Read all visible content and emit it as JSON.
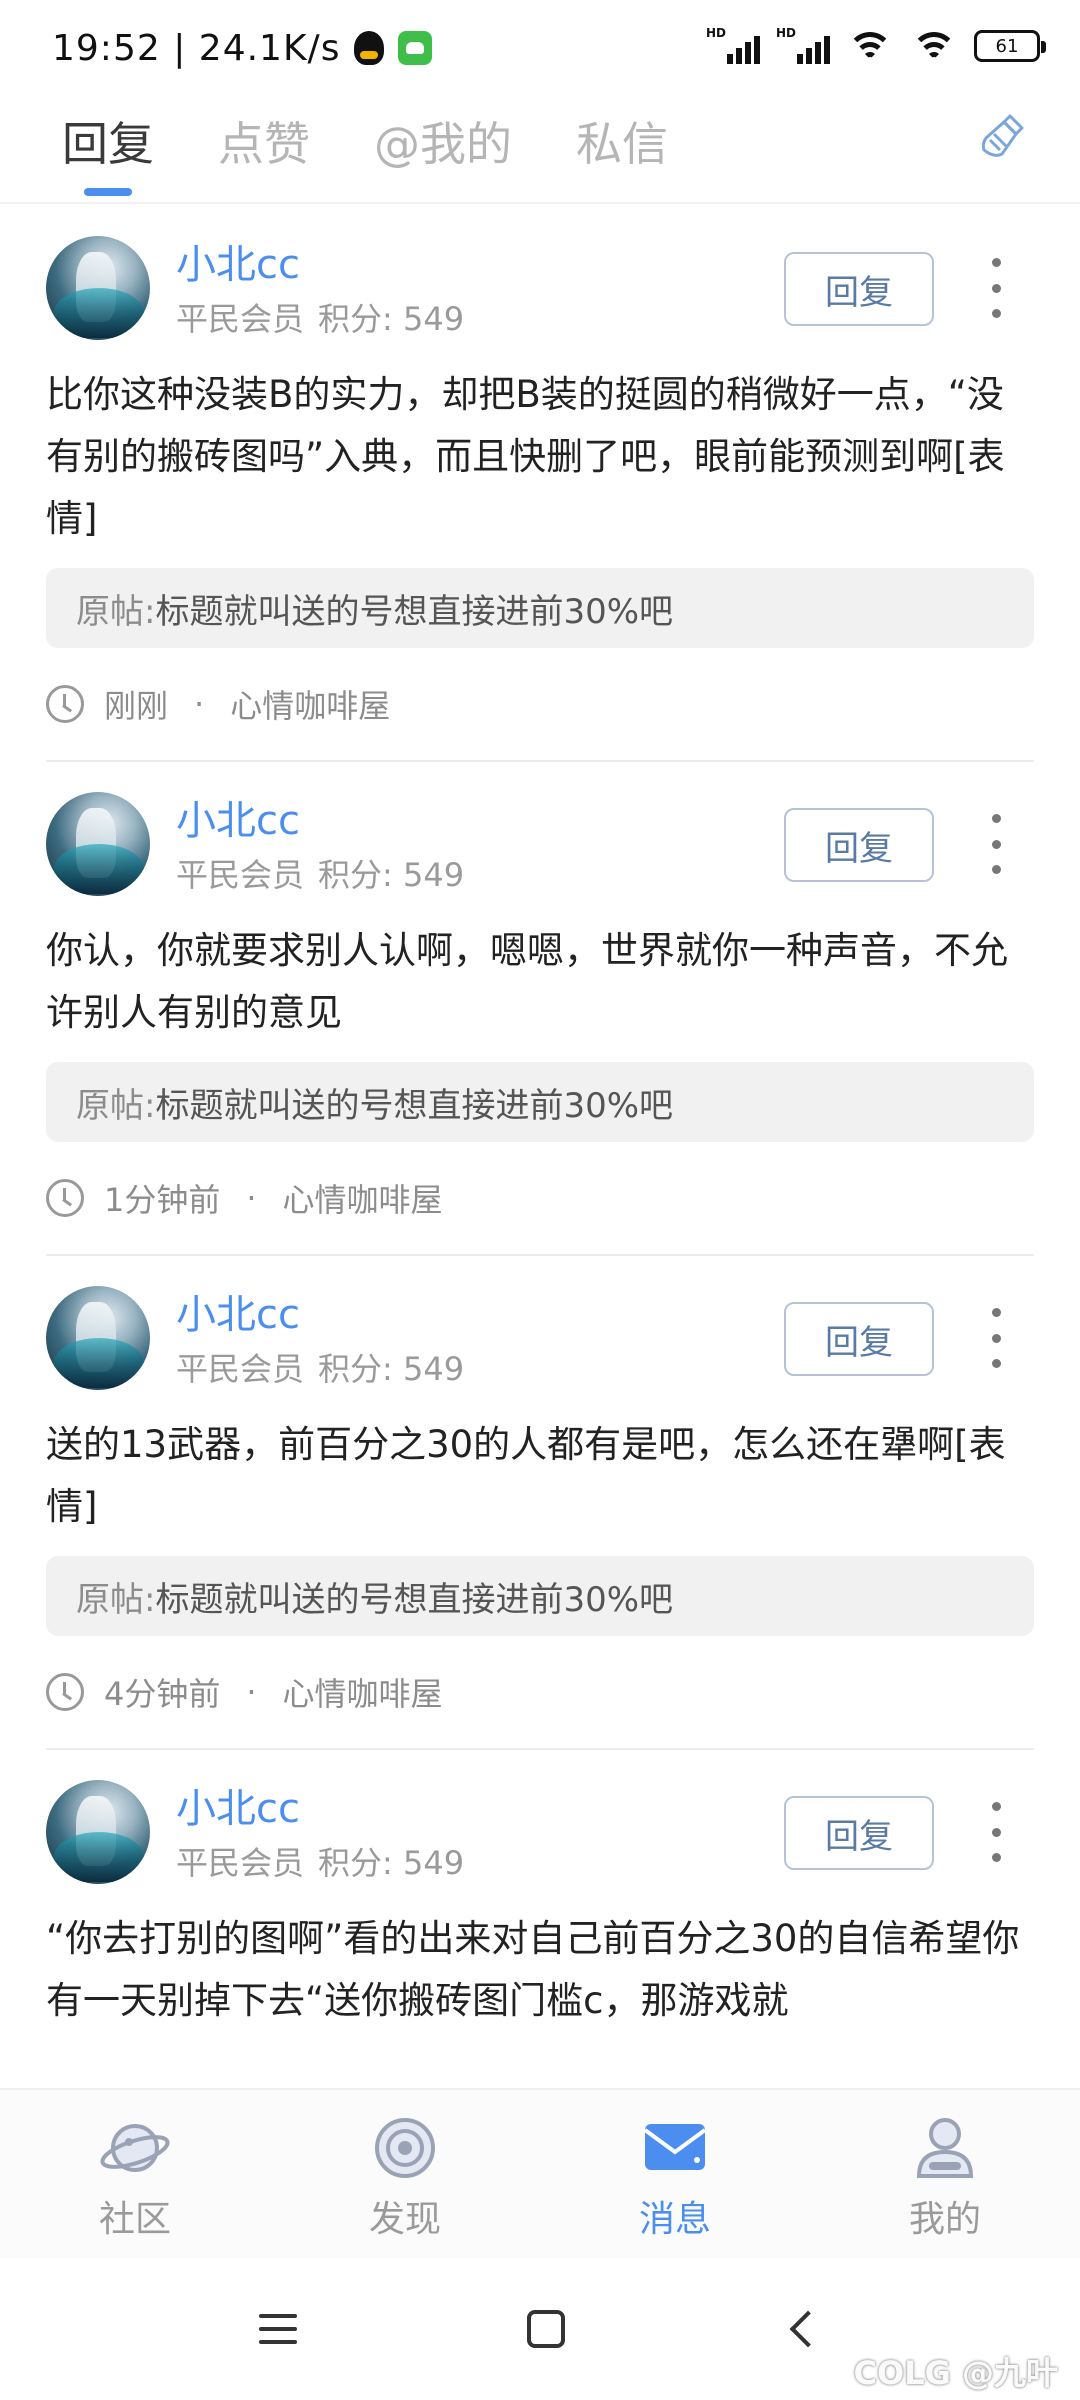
{
  "status_bar": {
    "time": "19:52",
    "speed": "24.1K/s",
    "separator": "|",
    "signal_label": "HD",
    "battery": "61"
  },
  "tabs": [
    {
      "label": "回复",
      "active": true
    },
    {
      "label": "点赞",
      "active": false
    },
    {
      "label": "@我的",
      "active": false
    },
    {
      "label": "私信",
      "active": false
    }
  ],
  "replies": [
    {
      "username": "小北cc",
      "rank": "平民会员",
      "points": "积分: 549",
      "reply_label": "回复",
      "content": "比你这种没装B的实力，却把B装的挺圆的稍微好一点，“没有别的搬砖图吗”入典，而且快删了吧，眼前能预测到啊[表情]",
      "quote_label": "原帖: ",
      "quote_text": "标题就叫送的号想直接进前30%吧",
      "time": "刚刚",
      "forum": "心情咖啡屋"
    },
    {
      "username": "小北cc",
      "rank": "平民会员",
      "points": "积分: 549",
      "reply_label": "回复",
      "content": "你认，你就要求别人认啊，嗯嗯，世界就你一种声音，不允许别人有别的意见",
      "quote_label": "原帖: ",
      "quote_text": "标题就叫送的号想直接进前30%吧",
      "time": "1分钟前",
      "forum": "心情咖啡屋"
    },
    {
      "username": "小北cc",
      "rank": "平民会员",
      "points": "积分: 549",
      "reply_label": "回复",
      "content": "送的13武器，前百分之30的人都有是吧，怎么还在犟啊[表情]",
      "quote_label": "原帖: ",
      "quote_text": "标题就叫送的号想直接进前30%吧",
      "time": "4分钟前",
      "forum": "心情咖啡屋"
    },
    {
      "username": "小北cc",
      "rank": "平民会员",
      "points": "积分: 549",
      "reply_label": "回复",
      "content": "“你去打别的图啊”看的出来对自己前百分之30的自信希望你有一天别掉下去“送你搬砖图门槛c，那游戏就",
      "quote_label": "",
      "quote_text": "",
      "time": "",
      "forum": ""
    }
  ],
  "bottom_nav": [
    {
      "label": "社区",
      "icon": "planet-icon",
      "active": false
    },
    {
      "label": "发现",
      "icon": "target-icon",
      "active": false
    },
    {
      "label": "消息",
      "icon": "mail-icon",
      "active": true
    },
    {
      "label": "我的",
      "icon": "profile-icon",
      "active": false
    }
  ],
  "watermark": "COLG @九叶",
  "colors": {
    "accent": "#4b8ef0",
    "inactive": "#9a9a9a"
  }
}
